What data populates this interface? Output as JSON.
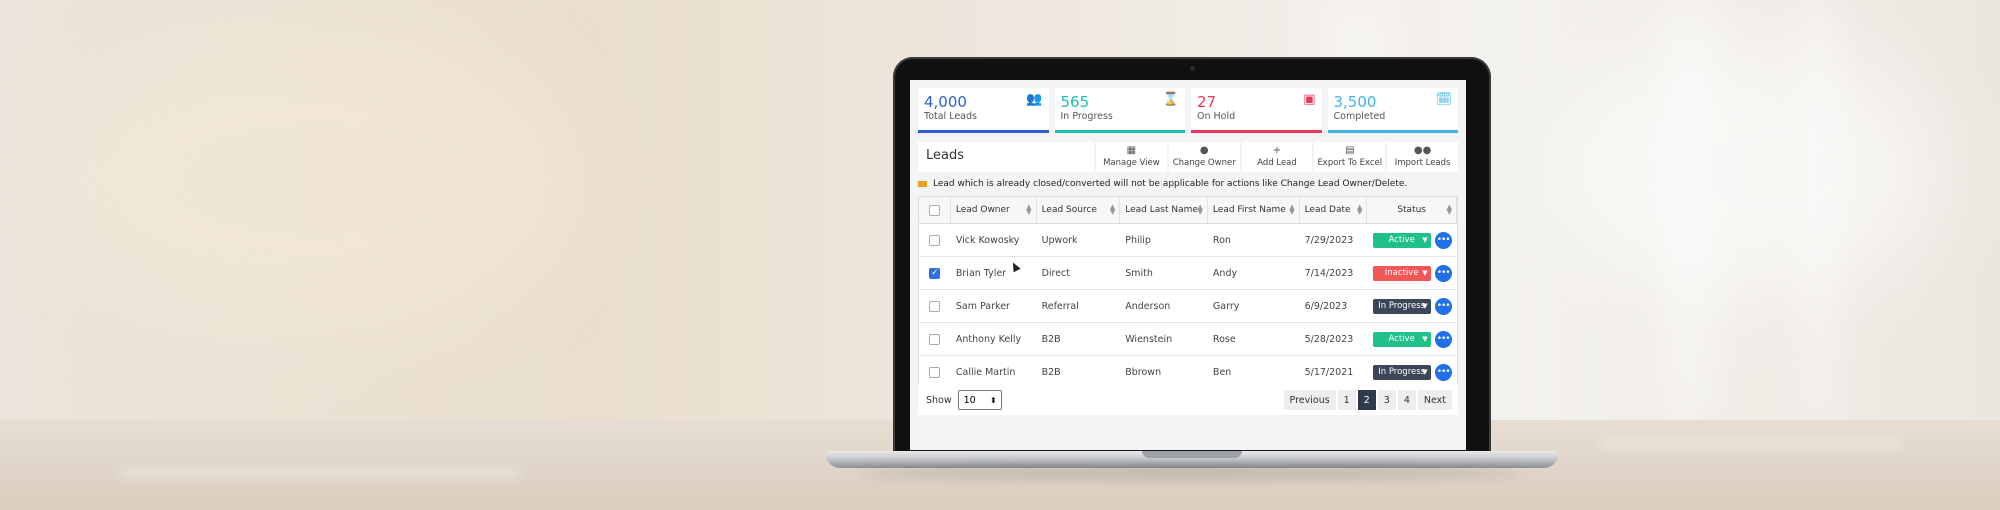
{
  "stats": [
    {
      "value": "4,000",
      "label": "Total Leads",
      "color": "#2f5fd4",
      "icon": "users-icon",
      "glyph": "👥"
    },
    {
      "value": "565",
      "label": "In Progress",
      "color": "#1dbdb4",
      "icon": "hourglass-icon",
      "glyph": "⌛"
    },
    {
      "value": "27",
      "label": "On Hold",
      "color": "#e8395a",
      "icon": "pause-document-icon",
      "glyph": "▣"
    },
    {
      "value": "3,500",
      "label": "Completed",
      "color": "#3fb3e8",
      "icon": "calendar-check-icon",
      "glyph": "🗓"
    }
  ],
  "toolbar": {
    "title": "Leads",
    "tools": [
      {
        "label": "Manage View",
        "icon": "table-icon",
        "glyph": "▦"
      },
      {
        "label": "Change Owner",
        "icon": "person-icon",
        "glyph": "●"
      },
      {
        "label": "Add Lead",
        "icon": "plus-icon",
        "glyph": "+"
      },
      {
        "label": "Export To Excel",
        "icon": "file-icon",
        "glyph": "▤"
      },
      {
        "label": "Import Leads",
        "icon": "group-icon",
        "glyph": "●●"
      }
    ]
  },
  "notice": "Lead which is already closed/converted will not be applicable for actions like Change Lead Owner/Delete.",
  "table": {
    "headers": [
      "Lead Owner",
      "Lead Source",
      "Lead Last Name",
      "Lead First Name",
      "Lead Date",
      "Status"
    ],
    "rows": [
      {
        "owner": "Vick Kowosky",
        "source": "Upwork",
        "last": "Philip",
        "first": "Ron",
        "date": "7/29/2023",
        "status": "Active",
        "checked": false
      },
      {
        "owner": "Brian Tyler",
        "source": "Direct",
        "last": "Smith",
        "first": "Andy",
        "date": "7/14/2023",
        "status": "Inactive",
        "checked": true
      },
      {
        "owner": "Sam Parker",
        "source": "Referral",
        "last": "Anderson",
        "first": "Garry",
        "date": "6/9/2023",
        "status": "In Progress",
        "checked": false
      },
      {
        "owner": "Anthony Kelly",
        "source": "B2B",
        "last": "Wienstein",
        "first": "Rose",
        "date": "5/28/2023",
        "status": "Active",
        "checked": false
      },
      {
        "owner": "Callie Martin",
        "source": "B2B",
        "last": "Bbrown",
        "first": "Ben",
        "date": "5/17/2021",
        "status": "In Progress",
        "checked": false
      }
    ]
  },
  "status_colors": {
    "Active": "#20c08a",
    "Inactive": "#f25757",
    "In Progress": "#3b4759"
  },
  "footer": {
    "show_label": "Show",
    "page_size": "10",
    "previous": "Previous",
    "pages": [
      "1",
      "2",
      "3",
      "4"
    ],
    "active_page": "2",
    "next": "Next"
  }
}
